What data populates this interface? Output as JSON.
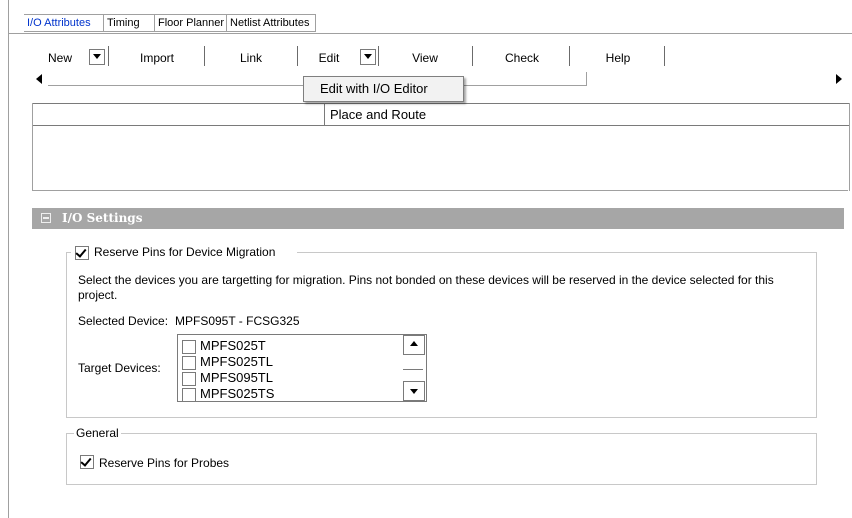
{
  "tabs": [
    {
      "label": "I/O Attributes",
      "active": true
    },
    {
      "label": "Timing",
      "active": false
    },
    {
      "label": "Floor Planner",
      "active": false
    },
    {
      "label": "Netlist Attributes",
      "active": false
    }
  ],
  "toolbar": {
    "new_label": "New",
    "import_label": "Import",
    "link_label": "Link",
    "edit_label": "Edit",
    "view_label": "View",
    "check_label": "Check",
    "help_label": "Help"
  },
  "popup": {
    "item_label": "Edit with I/O Editor"
  },
  "table": {
    "column_header": "Place and Route"
  },
  "io_settings": {
    "title": "I/O Settings",
    "reserve_migration": {
      "label": "Reserve Pins for Device Migration",
      "checked": true
    },
    "description": "Select the devices you are targetting for migration. Pins not bonded on these devices will be reserved in the device selected for this project.",
    "selected_device_label": "Selected Device:",
    "selected_device_value": "MPFS095T - FCSG325",
    "target_devices_label": "Target Devices:",
    "target_devices": [
      {
        "name": "MPFS025T",
        "checked": false
      },
      {
        "name": "MPFS025TL",
        "checked": false
      },
      {
        "name": "MPFS095TL",
        "checked": false
      },
      {
        "name": "MPFS025TS",
        "checked": false
      }
    ]
  },
  "general": {
    "legend": "General",
    "reserve_probes": {
      "label": "Reserve Pins for Probes",
      "checked": true
    }
  },
  "colors": {
    "active_tab": "#0033cc",
    "section_header_bg": "#a6a6a6",
    "section_header_text": "#ffffff"
  }
}
